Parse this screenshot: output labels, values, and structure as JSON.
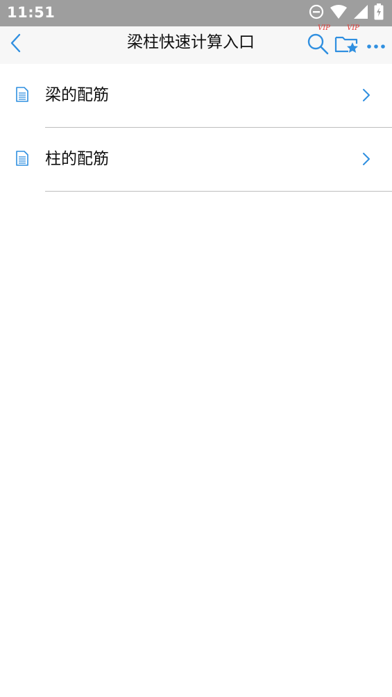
{
  "status_bar": {
    "time": "11:51",
    "icons": [
      "do-not-disturb-icon",
      "wifi-icon",
      "signal-icon",
      "battery-charging-icon"
    ]
  },
  "app_bar": {
    "title": "梁柱快速计算入口",
    "back_icon": "chevron-left-icon",
    "actions": [
      {
        "name": "search",
        "icon": "search-icon",
        "badge": "VIP"
      },
      {
        "name": "favorites",
        "icon": "folder-star-icon",
        "badge": "VIP"
      },
      {
        "name": "more",
        "icon": "more-horizontal-icon"
      }
    ]
  },
  "list": {
    "items": [
      {
        "label": "梁的配筋",
        "icon": "document-icon"
      },
      {
        "label": "柱的配筋",
        "icon": "document-icon"
      }
    ]
  },
  "colors": {
    "accent": "#2f8fe0",
    "status_bar": "#9e9e9e",
    "app_bar": "#f7f7f7",
    "vip_badge": "#e53935",
    "divider": "#bdbdbd"
  }
}
